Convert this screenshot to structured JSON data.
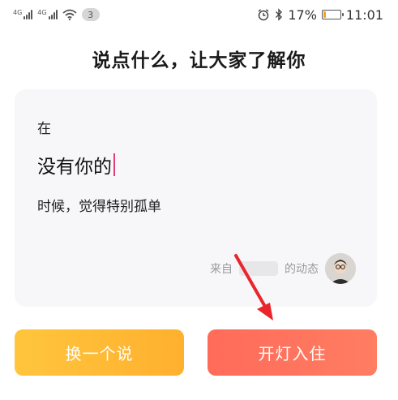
{
  "status_bar": {
    "signal1_label": "4G",
    "signal2_label": "4G",
    "notification_count": "3",
    "battery_percent": "17%",
    "battery_level": 0.17,
    "time": "11:01"
  },
  "page": {
    "title": "说点什么，让大家了解你"
  },
  "card": {
    "line1": "在",
    "line2": "没有你的",
    "line3": "时候，觉得特别孤单",
    "source_prefix": "来自",
    "source_suffix": "的动态"
  },
  "buttons": {
    "change_label": "换一个说",
    "checkin_label": "开灯入住"
  },
  "colors": {
    "accent_yellow": "#ffb02e",
    "accent_red": "#ff6b5a",
    "cursor": "#e33d73"
  }
}
